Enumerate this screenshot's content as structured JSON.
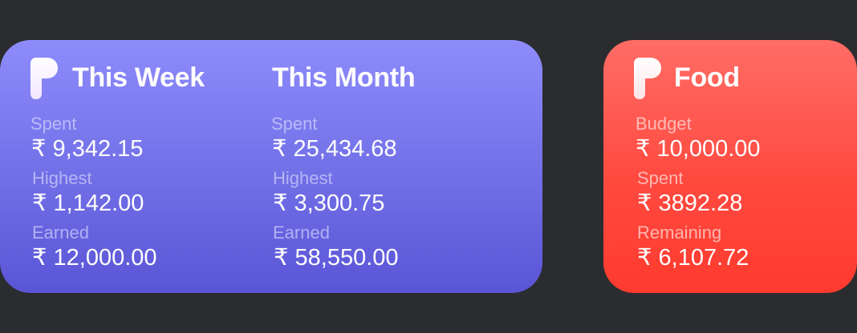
{
  "weekly_widget": {
    "this_week": {
      "title": "This Week",
      "stats": [
        {
          "label": "Spent",
          "value": "₹ 9,342.15"
        },
        {
          "label": "Highest",
          "value": "₹ 1,142.00"
        },
        {
          "label": "Earned",
          "value": "₹ 12,000.00"
        }
      ]
    },
    "this_month": {
      "title": "This Month",
      "stats": [
        {
          "label": "Spent",
          "value": "₹ 25,434.68"
        },
        {
          "label": "Highest",
          "value": "₹ 3,300.75"
        },
        {
          "label": "Earned",
          "value": "₹ 58,550.00"
        }
      ]
    },
    "logo_icon": "app-logo-p-icon",
    "colors": {
      "gradient_top": "#8e8cfb",
      "gradient_bottom": "#5a55d6"
    }
  },
  "budget_widget": {
    "title": "Food",
    "stats": [
      {
        "label": "Budget",
        "value": "₹ 10,000.00"
      },
      {
        "label": "Spent",
        "value": "₹ 3892.28"
      },
      {
        "label": "Remaining",
        "value": "₹ 6,107.72"
      }
    ],
    "logo_icon": "app-logo-p-icon",
    "colors": {
      "gradient_top": "#ff6d66",
      "gradient_bottom": "#ff3a2e"
    }
  }
}
